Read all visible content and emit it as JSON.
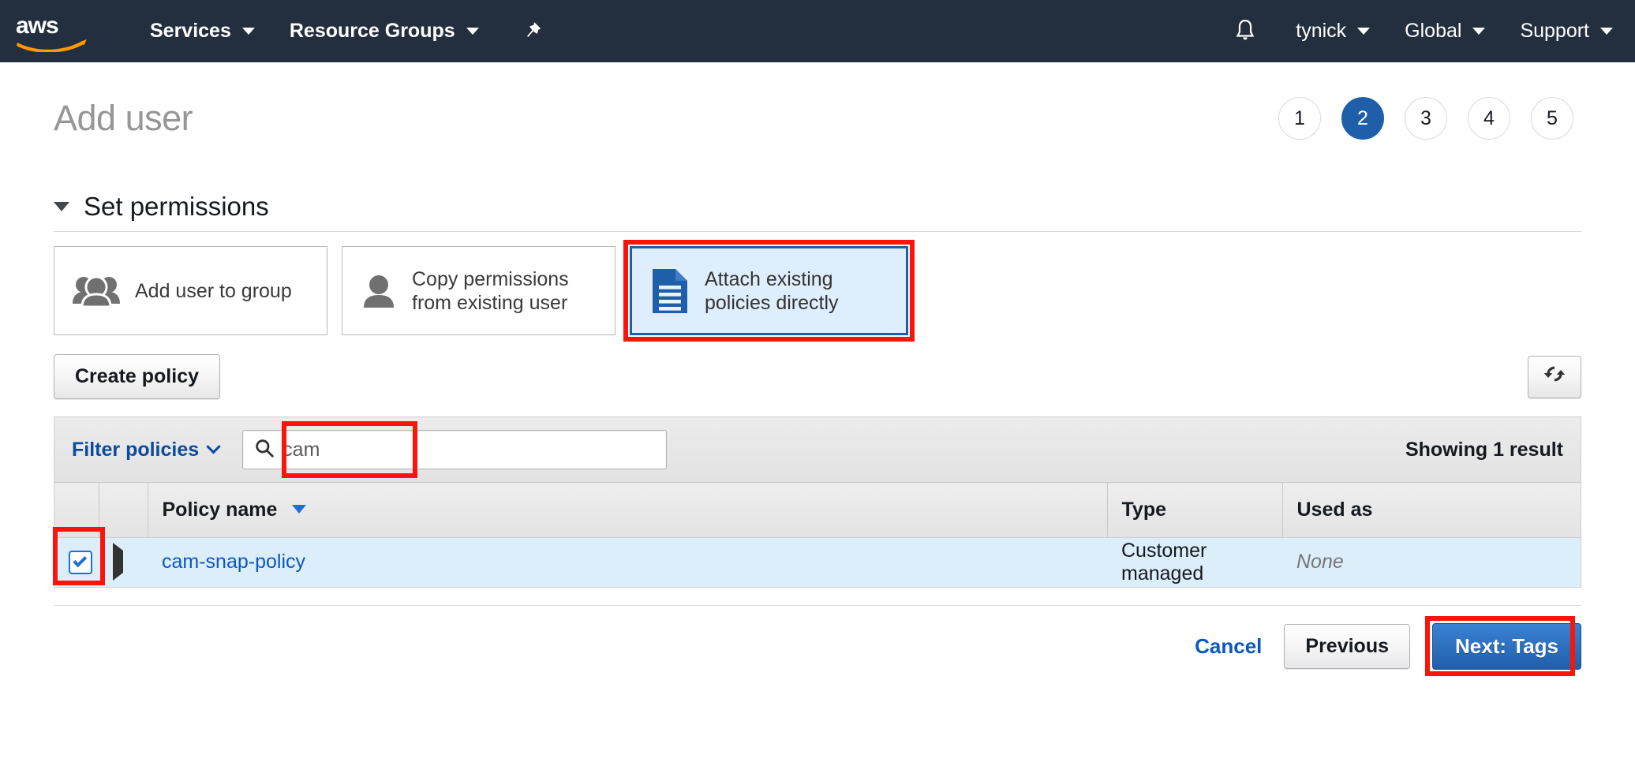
{
  "topnav": {
    "logo": "aws-logo",
    "services_label": "Services",
    "resource_groups_label": "Resource Groups",
    "pin_icon": "pushpin-icon",
    "bell_icon": "bell-icon",
    "account_label": "tynick",
    "region_label": "Global",
    "support_label": "Support",
    "bg_color": "#232f3e"
  },
  "header": {
    "title": "Add user",
    "steps": [
      "1",
      "2",
      "3",
      "4",
      "5"
    ],
    "active_step": "2",
    "active_color": "#1f5fa9"
  },
  "permissions": {
    "section_title": "Set permissions",
    "options": [
      {
        "label": "Add user to group",
        "icon": "users-group-icon",
        "selected": false
      },
      {
        "label": "Copy permissions from existing user",
        "icon": "user-icon",
        "selected": false
      },
      {
        "label": "Attach existing policies directly",
        "icon": "document-lines-icon",
        "selected": true
      }
    ],
    "create_policy_label": "Create policy",
    "refresh_icon": "refresh-icon"
  },
  "filter": {
    "filter_policies_label": "Filter policies",
    "search_icon": "search-icon",
    "search_value": "cam",
    "search_placeholder": "",
    "showing_label": "Showing 1 result"
  },
  "table": {
    "columns": [
      "",
      "",
      "Policy name",
      "Type",
      "Used as"
    ],
    "sort_column": "Policy name",
    "rows": [
      {
        "checked": true,
        "expand_icon": "triangle-right-icon",
        "policy_name": "cam-snap-policy",
        "type": "Customer managed",
        "used_as": "None"
      }
    ]
  },
  "footer": {
    "cancel_label": "Cancel",
    "previous_label": "Previous",
    "next_label": "Next: Tags"
  },
  "annotations": {
    "color": "#fc1309",
    "boxes": [
      "attach-policies-card",
      "search-input",
      "row-checkbox",
      "next-tags-button"
    ]
  }
}
